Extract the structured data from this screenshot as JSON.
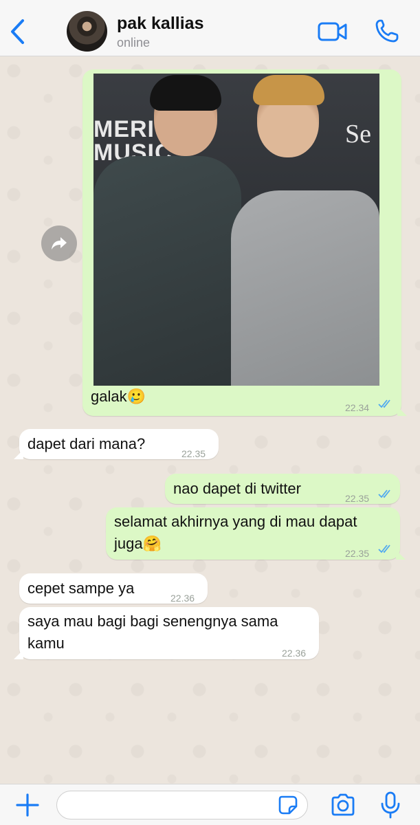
{
  "header": {
    "contact_name": "pak kallias",
    "status": "online"
  },
  "messages": [
    {
      "direction": "outgoing",
      "type": "image",
      "caption": "galak🥲",
      "time": "22.34",
      "read": true,
      "image_text": [
        "MERICA",
        "MUSIC"
      ],
      "image_text_right": "Se"
    },
    {
      "direction": "incoming",
      "text": "dapet dari mana?",
      "time": "22.35"
    },
    {
      "direction": "outgoing",
      "text": "nao dapet di twitter",
      "time": "22.35",
      "read": true
    },
    {
      "direction": "outgoing",
      "lines": [
        "selamat akhirnya yang di mau dapat",
        "juga🤗"
      ],
      "time": "22.35",
      "read": true
    },
    {
      "direction": "incoming",
      "text": "cepet sampe ya",
      "time": "22.36"
    },
    {
      "direction": "incoming",
      "lines": [
        "saya mau bagi bagi senengnya sama",
        "kamu"
      ],
      "time": "22.36"
    }
  ],
  "footer": {
    "input_placeholder": ""
  },
  "colors": {
    "accent": "#1a7cf5",
    "outgoing_bubble": "#dcf8c6",
    "incoming_bubble": "#ffffff",
    "read_ticks": "#4fa8f0",
    "wallpaper": "#ece5dd"
  },
  "icons": [
    "chevron-left-icon",
    "video-camera-icon",
    "phone-icon",
    "forward-icon",
    "plus-icon",
    "sticker-icon",
    "camera-icon",
    "microphone-icon",
    "double-check-icon"
  ]
}
